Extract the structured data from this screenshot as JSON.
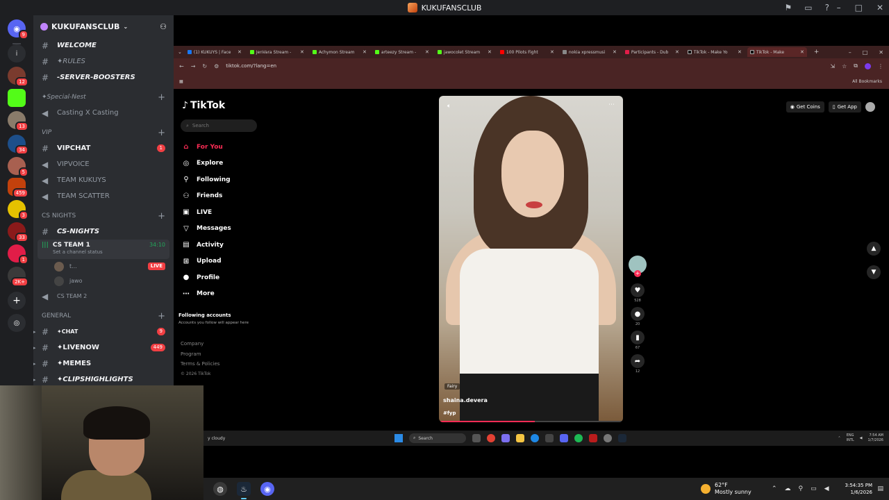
{
  "window": {
    "title": "KUKUFANSCLUB"
  },
  "server": {
    "name": "KUKUFANSCLUB"
  },
  "rail_badges": [
    "9",
    "12",
    "13",
    "34",
    "5",
    "459",
    "3",
    "33",
    "1",
    "2K+"
  ],
  "channels": {
    "welcome": "WELCOME",
    "rules": "✦RULES",
    "server_boosters": "-SERVER-BOOSTERS",
    "cat_special": "✦Special-Nest",
    "casting": "Casting X Casting",
    "cat_vip": "VIP",
    "vipchat": "VIPCHAT",
    "vipchat_count": "1",
    "vipvoice": "VIPVOICE",
    "team_kukuys": "TEAM KUKUYS",
    "team_scatter": "TEAM SCATTER",
    "cat_cs": "CS NIGHTS",
    "cs_nights": "CS-NIGHTS",
    "cs_team1": "CS TEAM 1",
    "cs_team1_time": "34:10",
    "cs_team1_status": "Set a channel status",
    "voice_user1": "t...",
    "voice_user1_live": "LIVE",
    "voice_user2": "jawo",
    "cs_team2": "CS TEAM 2",
    "cat_general": "GENERAL",
    "chat": "✦CHAT",
    "chat_count": "9",
    "livenow": "✦LIVENOW",
    "livenow_count": "449",
    "memes": "✦MEMES",
    "clips": "✦CLIPSHIGHLIGHTS"
  },
  "browser": {
    "tabs": [
      {
        "label": "(1) KUKUYS | Face",
        "color": "#1877f2"
      },
      {
        "label": "JenVara Stream -",
        "color": "#53fc18"
      },
      {
        "label": "Achymon Stream",
        "color": "#53fc18"
      },
      {
        "label": "arteezy Stream -",
        "color": "#53fc18"
      },
      {
        "label": "jawocolet Stream",
        "color": "#53fc18"
      },
      {
        "label": "100 Pilots Fight",
        "color": "#ff0000"
      },
      {
        "label": "nokia xpressmusi",
        "color": "#888888"
      },
      {
        "label": "Participants - Dub",
        "color": "#e11d48"
      },
      {
        "label": "TikTok - Make Yo",
        "color": "#000000"
      },
      {
        "label": "TikTok - Make",
        "color": "#000000"
      }
    ],
    "url": "tiktok.com/?lang=en",
    "bookmarks": "All Bookmarks"
  },
  "tiktok": {
    "logo": "TikTok",
    "search_placeholder": "Search",
    "nav": [
      {
        "label": "For You",
        "icon": "home-icon"
      },
      {
        "label": "Explore",
        "icon": "compass-icon"
      },
      {
        "label": "Following",
        "icon": "following-icon"
      },
      {
        "label": "Friends",
        "icon": "friends-icon"
      },
      {
        "label": "LIVE",
        "icon": "live-icon"
      },
      {
        "label": "Messages",
        "icon": "messages-icon"
      },
      {
        "label": "Activity",
        "icon": "activity-icon"
      },
      {
        "label": "Upload",
        "icon": "upload-icon"
      },
      {
        "label": "Profile",
        "icon": "profile-icon"
      },
      {
        "label": "More",
        "icon": "more-icon"
      }
    ],
    "following_title": "Following accounts",
    "following_sub": "Accounts you follow will appear here",
    "footer": [
      "Company",
      "Program",
      "Terms & Policies"
    ],
    "copyright": "© 2026 TikTok",
    "get_coins": "Get Coins",
    "get_app": "Get App",
    "video": {
      "tag": "Fairy",
      "author": "shaina.devera",
      "hashtag": "#fyp",
      "progress": 0.52
    },
    "counts": {
      "likes": "528",
      "comments": "20",
      "saves": "67",
      "shares": "12"
    }
  },
  "inner_taskbar": {
    "weather": "y cloudy",
    "search": "Search",
    "lang": "ENG",
    "lang2": "INTL",
    "time": "7:54 AM",
    "date": "1/7/2026"
  },
  "taskbar": {
    "temp": "62°F",
    "condition": "Mostly sunny",
    "time": "3:54:35 PM",
    "date": "1/6/2026"
  }
}
